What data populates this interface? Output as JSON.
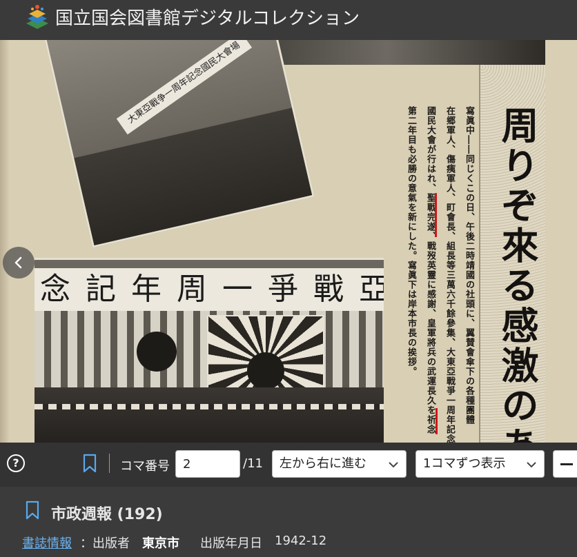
{
  "header": {
    "site_title": "国立国会図書館デジタルコレクション"
  },
  "viewer": {
    "headline": "周りぞ來る感激のあの日",
    "photo_top_banner": "大東亞戰争一周年記念國民大會場",
    "photo_bottom_banner": "念記年周一爭戰亞東",
    "body_columns": [
      "寫眞中――同じくこの日、午後二時靖國の社頭に、翼賛會傘下の各種團體",
      "在郷軍人、傷痍軍人、町會長、組長等三萬六千餘參集、大東亞戰爭一周年記念",
      "國民大會が行はれ、聖戰完遂、戰歿英靈に感謝、皇軍將兵の武運長久を祈念",
      "第二年目も必勝の意氣を新にした。寫眞下は岸本市長の挨拶。"
    ],
    "prev_icon": "chevron-left-icon"
  },
  "toolbar": {
    "help_label": "?",
    "koma_label": "コマ番号",
    "koma_value": "2",
    "koma_total": "/11",
    "direction_select": "左から右に進む",
    "display_select": "1コマずつ表示"
  },
  "info": {
    "title": "市政週報 (192)",
    "biblio_link": "書誌情報",
    "publisher_label": "：出版者",
    "publisher": "東京市",
    "date_label": "出版年月日",
    "date": "1942-12"
  }
}
